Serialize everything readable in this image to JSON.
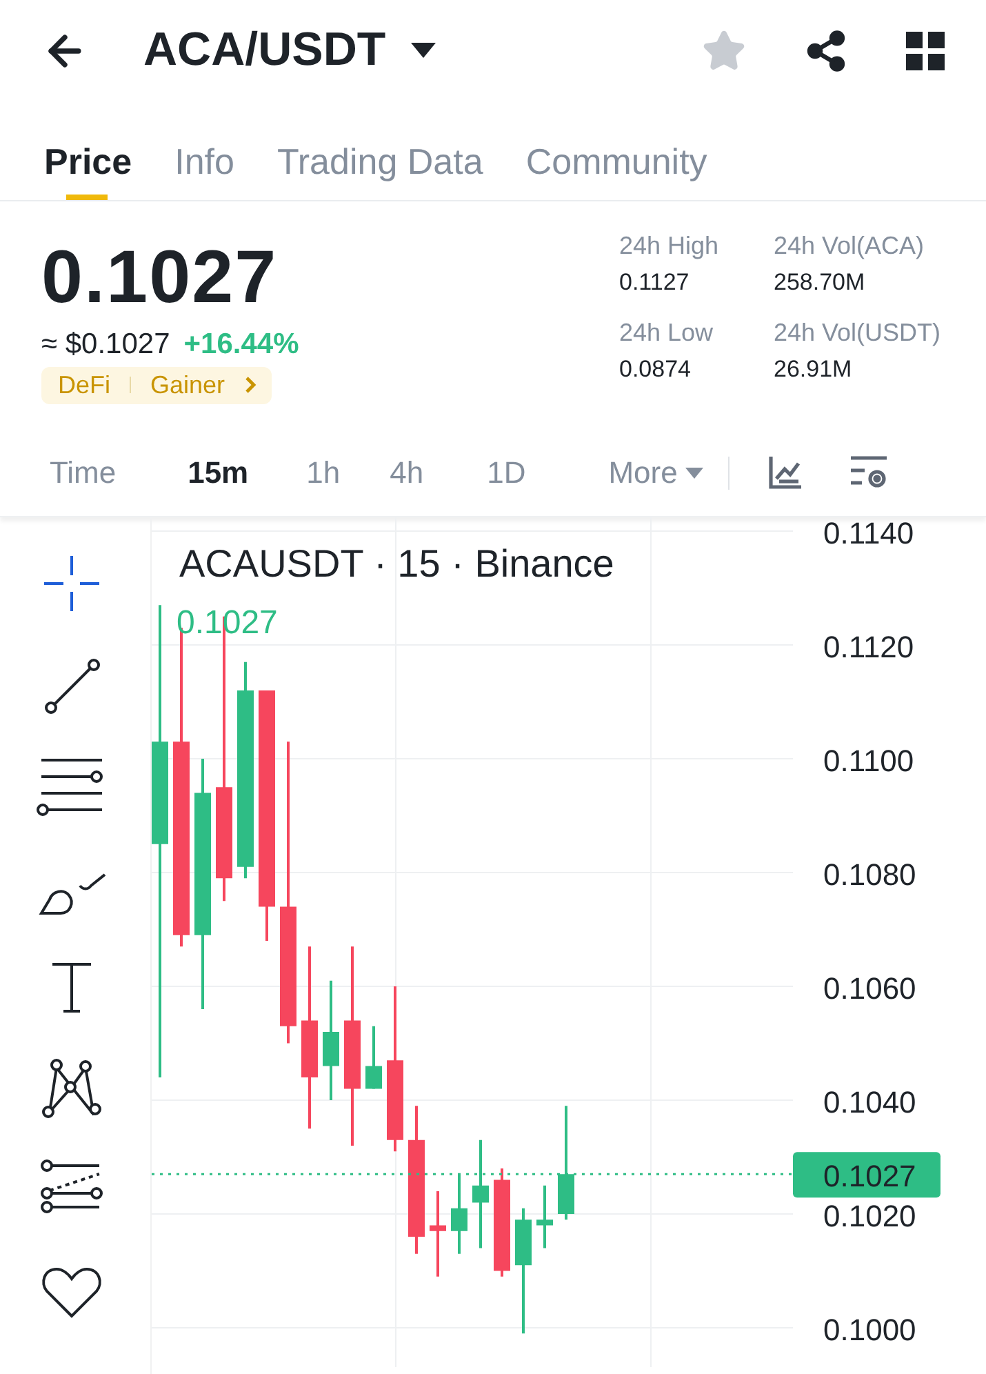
{
  "header": {
    "title": "ACA/USDT",
    "favorite": false
  },
  "tabs": [
    {
      "label": "Price",
      "selected": true
    },
    {
      "label": "Info",
      "selected": false
    },
    {
      "label": "Trading Data",
      "selected": false
    },
    {
      "label": "Community",
      "selected": false
    }
  ],
  "price": {
    "last": "0.1027",
    "fiat": "≈ $0.1027",
    "change": "+16.44%",
    "tags": [
      "DeFi",
      "Gainer"
    ]
  },
  "stats": [
    {
      "label": "24h High",
      "value": "0.1127"
    },
    {
      "label": "24h Vol(ACA)",
      "value": "258.70M"
    },
    {
      "label": "24h Low",
      "value": "0.0874"
    },
    {
      "label": "24h Vol(USDT)",
      "value": "26.91M"
    }
  ],
  "intervals": [
    {
      "label": "Time",
      "selected": false
    },
    {
      "label": "15m",
      "selected": true
    },
    {
      "label": "1h",
      "selected": false
    },
    {
      "label": "4h",
      "selected": false
    },
    {
      "label": "1D",
      "selected": false
    },
    {
      "label": "More",
      "selected": false
    }
  ],
  "tools": [
    {
      "kind": "crosshair",
      "selected": true
    },
    {
      "kind": "trendline",
      "selected": false
    },
    {
      "kind": "fib",
      "selected": false
    },
    {
      "kind": "brush",
      "selected": false
    },
    {
      "kind": "text",
      "selected": false
    },
    {
      "kind": "pattern",
      "selected": false
    },
    {
      "kind": "measure",
      "selected": false
    },
    {
      "kind": "favorite",
      "selected": false
    }
  ],
  "chart": {
    "title": "ACAUSDT · 15 · Binance",
    "last_label": "0.1027",
    "last_tag": "0.1027",
    "axis_labels": [
      "0.1140",
      "0.1120",
      "0.1100",
      "0.1080",
      "0.1060",
      "0.1040",
      "0.1020",
      "0.1000"
    ]
  }
}
